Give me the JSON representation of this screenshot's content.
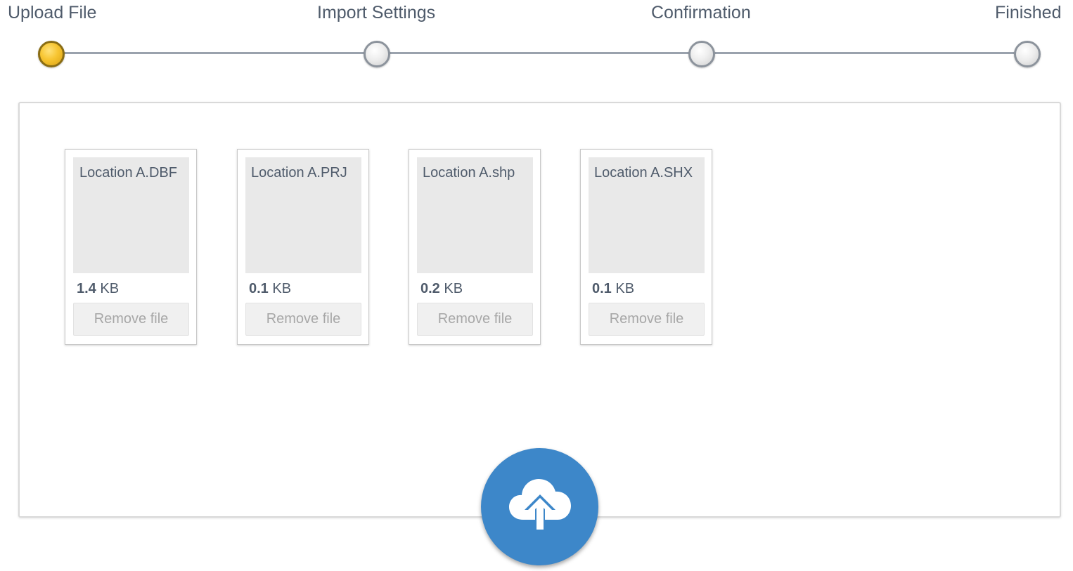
{
  "stepper": {
    "steps": [
      {
        "label": "Upload File",
        "active": true
      },
      {
        "label": "Import Settings",
        "active": false
      },
      {
        "label": "Confirmation",
        "active": false
      },
      {
        "label": "Finished",
        "active": false
      }
    ],
    "active_color": "#f7c531",
    "inactive_color": "#eeeeee"
  },
  "files": [
    {
      "name": "Location A.DBF",
      "size_value": "1.4",
      "size_unit": "KB",
      "remove_label": "Remove file"
    },
    {
      "name": "Location A.PRJ",
      "size_value": "0.1",
      "size_unit": "KB",
      "remove_label": "Remove file"
    },
    {
      "name": "Location A.shp",
      "size_value": "0.2",
      "size_unit": "KB",
      "remove_label": "Remove file"
    },
    {
      "name": "Location A.SHX",
      "size_value": "0.1",
      "size_unit": "KB",
      "remove_label": "Remove file"
    }
  ],
  "upload_button": {
    "icon": "cloud-upload-icon",
    "color": "#3d87c9"
  }
}
